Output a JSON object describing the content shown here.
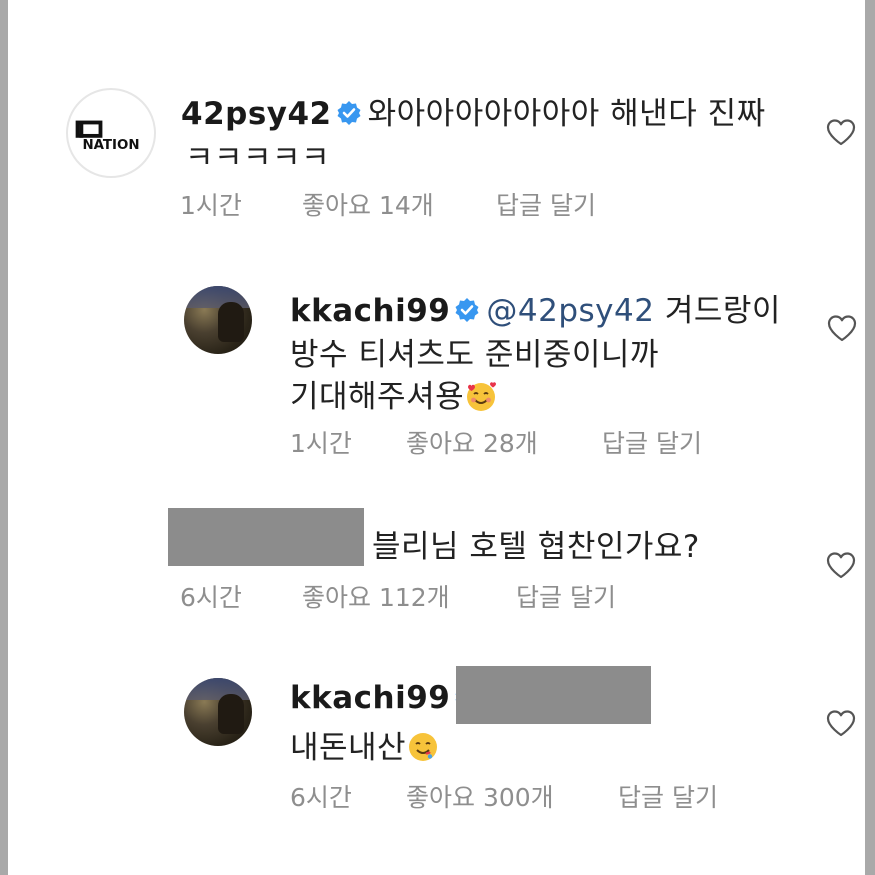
{
  "comments": [
    {
      "username": "42psy42",
      "avatar_text": "NATION",
      "text_line1": "와아아아아아아아 해낸다 진짜",
      "text_line2": "ㅋㅋㅋㅋㅋ",
      "time": "1시간",
      "likes": "좋아요 14개",
      "reply": "답글 달기"
    },
    {
      "username": "kkachi99",
      "mention": "@42psy42",
      "text_line1": "겨드랑이",
      "text_line2": "방수 티셔츠도 준비중이니까",
      "text_line3": "기대해주셔용",
      "emoji": "smiling-face-with-hearts",
      "time": "1시간",
      "likes": "좋아요 28개",
      "reply": "답글 달기"
    },
    {
      "text_line1": "블리님 호텔 협찬인가요?",
      "time": "6시간",
      "likes": "좋아요 112개",
      "reply": "답글 달기"
    },
    {
      "username": "kkachi99",
      "text_line1": "내돈내산",
      "emoji": "drooling-face",
      "time": "6시간",
      "likes": "좋아요 300개",
      "reply": "답글 달기"
    }
  ],
  "colors": {
    "verified_blue": "#3897f0",
    "meta_gray": "#8e8e8e",
    "redaction_gray": "#8c8c8c"
  }
}
